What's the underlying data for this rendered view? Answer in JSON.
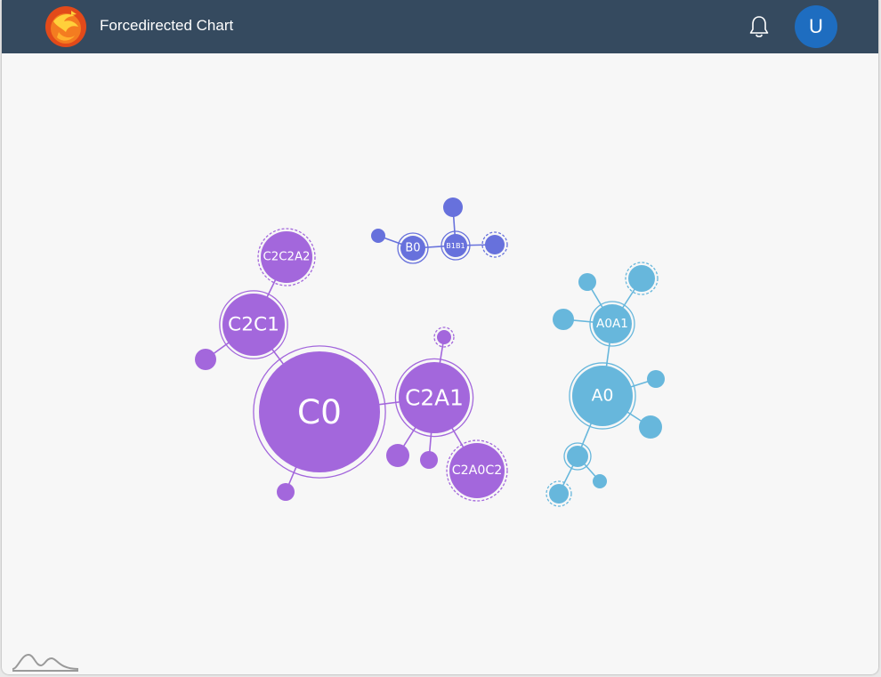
{
  "header": {
    "title": "Forcedirected Chart",
    "logo_icon": "phoenix-logo-icon",
    "bell_icon": "bell-icon",
    "avatar_initial": "U"
  },
  "colors": {
    "header_bg": "#354a5f",
    "group_c": "#a367dc",
    "group_b": "#6771dc",
    "group_a": "#67b7dc",
    "avatar_bg": "#1e6dc0"
  },
  "chart_data": {
    "type": "force-directed",
    "nodes": [
      {
        "id": "C0",
        "label": "C0",
        "group": "c",
        "value": 100,
        "ring": "solid"
      },
      {
        "id": "C2C1",
        "label": "C2C1",
        "group": "c",
        "value": 35,
        "ring": "solid"
      },
      {
        "id": "C2C2A2",
        "label": "C2C2A2",
        "group": "c",
        "value": 30,
        "ring": "dashed"
      },
      {
        "id": "C2A1",
        "label": "C2A1",
        "group": "c",
        "value": 40,
        "ring": "solid"
      },
      {
        "id": "C2A0C2",
        "label": "C2A0C2",
        "group": "c",
        "value": 32,
        "ring": "dashed"
      },
      {
        "id": "c_leaf1",
        "label": "",
        "group": "c",
        "value": 8,
        "ring": "none"
      },
      {
        "id": "c_leaf2",
        "label": "",
        "group": "c",
        "value": 7,
        "ring": "none"
      },
      {
        "id": "c_leaf3",
        "label": "",
        "group": "c",
        "value": 6,
        "ring": "dashed"
      },
      {
        "id": "c_leaf4",
        "label": "",
        "group": "c",
        "value": 9,
        "ring": "none"
      },
      {
        "id": "c_leaf5",
        "label": "",
        "group": "c",
        "value": 7,
        "ring": "none"
      },
      {
        "id": "B0",
        "label": "B0",
        "group": "b",
        "value": 12,
        "ring": "solid"
      },
      {
        "id": "B1B1",
        "label": "B1B1",
        "group": "b",
        "value": 11,
        "ring": "solid"
      },
      {
        "id": "b_leaf1",
        "label": "",
        "group": "b",
        "value": 6,
        "ring": "none"
      },
      {
        "id": "b_leaf2",
        "label": "",
        "group": "b",
        "value": 7,
        "ring": "none"
      },
      {
        "id": "b_leaf3",
        "label": "",
        "group": "b",
        "value": 8,
        "ring": "dashed"
      },
      {
        "id": "A0",
        "label": "A0",
        "group": "a",
        "value": 45,
        "ring": "solid"
      },
      {
        "id": "A0A1",
        "label": "A0A1",
        "group": "a",
        "value": 22,
        "ring": "solid"
      },
      {
        "id": "a_leaf1",
        "label": "",
        "group": "a",
        "value": 7,
        "ring": "none"
      },
      {
        "id": "a_leaf2",
        "label": "",
        "group": "a",
        "value": 9,
        "ring": "none"
      },
      {
        "id": "a_leaf3",
        "label": "",
        "group": "a",
        "value": 12,
        "ring": "dashed"
      },
      {
        "id": "a_leaf4",
        "label": "",
        "group": "a",
        "value": 7,
        "ring": "none"
      },
      {
        "id": "a_leaf5",
        "label": "",
        "group": "a",
        "value": 11,
        "ring": "none"
      },
      {
        "id": "a_leaf6",
        "label": "",
        "group": "a",
        "value": 9,
        "ring": "solid"
      },
      {
        "id": "a_leaf7",
        "label": "",
        "group": "a",
        "value": 8,
        "ring": "dashed"
      },
      {
        "id": "a_leaf8",
        "label": "",
        "group": "a",
        "value": 6,
        "ring": "none"
      }
    ],
    "links": [
      [
        "C0",
        "C2C1"
      ],
      [
        "C2C1",
        "C2C2A2"
      ],
      [
        "C2C1",
        "c_leaf1"
      ],
      [
        "C0",
        "c_leaf2"
      ],
      [
        "C0",
        "C2A1"
      ],
      [
        "C2A1",
        "c_leaf3"
      ],
      [
        "C2A1",
        "c_leaf4"
      ],
      [
        "C2A1",
        "c_leaf5"
      ],
      [
        "C2A1",
        "C2A0C2"
      ],
      [
        "B0",
        "b_leaf1"
      ],
      [
        "B0",
        "B1B1"
      ],
      [
        "B1B1",
        "b_leaf2"
      ],
      [
        "B1B1",
        "b_leaf3"
      ],
      [
        "A0",
        "A0A1"
      ],
      [
        "A0A1",
        "a_leaf1"
      ],
      [
        "A0A1",
        "a_leaf2"
      ],
      [
        "A0A1",
        "a_leaf3"
      ],
      [
        "A0",
        "a_leaf4"
      ],
      [
        "A0",
        "a_leaf5"
      ],
      [
        "A0",
        "a_leaf6"
      ],
      [
        "a_leaf6",
        "a_leaf7"
      ],
      [
        "a_leaf6",
        "a_leaf8"
      ]
    ]
  }
}
